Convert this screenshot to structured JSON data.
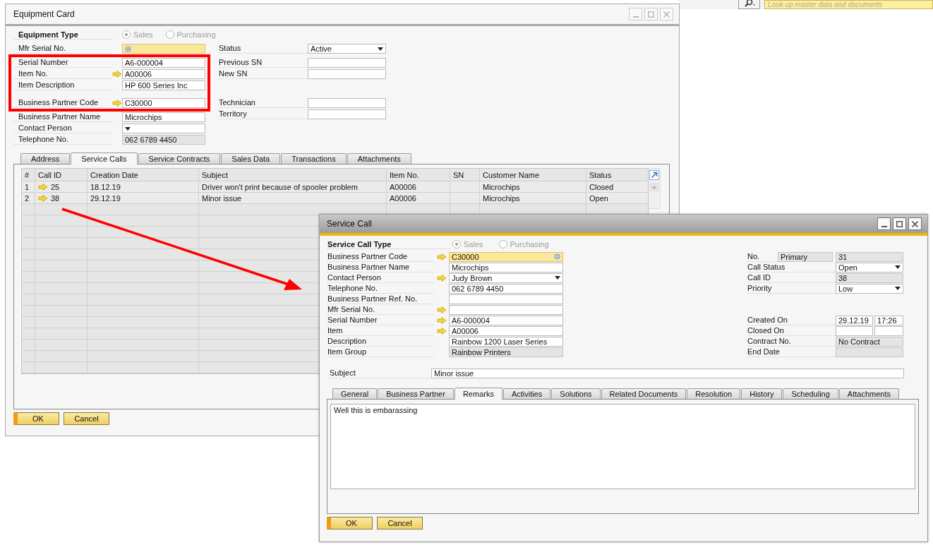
{
  "search": {
    "placeholder": "Look up master data and documents"
  },
  "equipment_card": {
    "title": "Equipment Card",
    "type": {
      "label": "Equipment Type",
      "options": [
        {
          "label": "Sales",
          "selected": true
        },
        {
          "label": "Purchasing",
          "selected": false
        }
      ]
    },
    "left_fields": [
      {
        "label": "Mfr Serial No.",
        "link": false,
        "inputs": [
          {
            "kind": "lookup"
          }
        ]
      },
      {
        "label": "Serial Number",
        "link": false,
        "inputs": [
          {
            "kind": "text",
            "value": "A6-000004"
          }
        ]
      },
      {
        "label": "Item No.",
        "link": true,
        "inputs": [
          {
            "kind": "text",
            "value": "A00006"
          }
        ]
      },
      {
        "label": "Item Description",
        "link": false,
        "inputs": [
          {
            "kind": "text",
            "value": "HP 600 Series Inc"
          }
        ]
      },
      {
        "label": "Business Partner Code",
        "link": true,
        "inputs": [
          {
            "kind": "text",
            "value": "C30000"
          }
        ]
      },
      {
        "label": "Business Partner Name",
        "link": false,
        "inputs": [
          {
            "kind": "text",
            "value": "Microchips"
          }
        ]
      },
      {
        "label": "Contact Person",
        "link": false,
        "inputs": [
          {
            "kind": "dropdown"
          }
        ]
      },
      {
        "label": "Telephone No.",
        "link": false,
        "inputs": [
          {
            "kind": "readonly",
            "value": "062 6789 4450"
          }
        ]
      }
    ],
    "right_fields": [
      {
        "label": "Status",
        "inputs": [
          {
            "kind": "dropdown",
            "value": "Active"
          }
        ]
      },
      {
        "label": "Previous SN",
        "inputs": [
          {
            "kind": "text"
          }
        ]
      },
      {
        "label": "New SN",
        "inputs": [
          {
            "kind": "text"
          }
        ]
      },
      {
        "label": "Technician",
        "inputs": [
          {
            "kind": "text"
          }
        ]
      },
      {
        "label": "Territory",
        "inputs": [
          {
            "kind": "text"
          }
        ]
      }
    ],
    "tabs": [
      {
        "label": "Address",
        "selected": false
      },
      {
        "label": "Service Calls",
        "selected": true
      },
      {
        "label": "Service Contracts",
        "selected": false
      },
      {
        "label": "Sales Data",
        "selected": false
      },
      {
        "label": "Transactions",
        "selected": false
      },
      {
        "label": "Attachments",
        "selected": false
      }
    ],
    "table": {
      "columns": [
        {
          "label": "#",
          "link": false
        },
        {
          "label": "Call ID",
          "link": true
        },
        {
          "label": "Creation Date",
          "link": false
        },
        {
          "label": "Subject",
          "link": false
        },
        {
          "label": "Item No.",
          "link": false
        },
        {
          "label": "SN",
          "link": false
        },
        {
          "label": "Customer Name",
          "link": false
        },
        {
          "label": "Status",
          "link": false
        }
      ],
      "rows": [
        [
          "1",
          "25",
          "18.12.19",
          "Driver won't print because of spooler problem",
          "A00006",
          "",
          "Microchips",
          "Closed"
        ],
        [
          "2",
          "38",
          "29.12.19",
          "Minor issue",
          "A00006",
          "",
          "Microchips",
          "Open"
        ]
      ]
    },
    "buttons": [
      "OK",
      "Cancel"
    ]
  },
  "service_call": {
    "title": "Service Call",
    "type": {
      "label": "Service Call Type",
      "options": [
        {
          "label": "Sales",
          "selected": true
        },
        {
          "label": "Purchasing",
          "selected": false
        }
      ]
    },
    "left_fields": [
      {
        "label": "Business Partner Code",
        "link": true,
        "inputs": [
          {
            "kind": "lookup",
            "value": "C30000"
          }
        ]
      },
      {
        "label": "Business Partner Name",
        "link": false,
        "inputs": [
          {
            "kind": "text",
            "value": "Microchips"
          }
        ]
      },
      {
        "label": "Contact Person",
        "link": true,
        "inputs": [
          {
            "kind": "dropdown",
            "value": "Judy Brown"
          }
        ]
      },
      {
        "label": "Telephone No.",
        "link": false,
        "inputs": [
          {
            "kind": "text",
            "value": "062 6789 4450"
          }
        ]
      },
      {
        "label": "Business Partner Ref. No.",
        "link": false,
        "inputs": [
          {
            "kind": "text"
          }
        ]
      },
      {
        "label": "Mfr Serial No.",
        "link": true,
        "inputs": [
          {
            "kind": "text"
          }
        ]
      },
      {
        "label": "Serial Number",
        "link": true,
        "inputs": [
          {
            "kind": "text",
            "value": "A6-000004"
          }
        ]
      },
      {
        "label": "Item",
        "link": true,
        "inputs": [
          {
            "kind": "text",
            "value": "A00006"
          }
        ]
      },
      {
        "label": "Description",
        "link": false,
        "inputs": [
          {
            "kind": "text",
            "value": "Rainbow 1200 Laser Series"
          }
        ]
      },
      {
        "label": "Item Group",
        "link": false,
        "inputs": [
          {
            "kind": "readonly",
            "value": "Rainbow Printers"
          }
        ]
      }
    ],
    "right_fields": [
      {
        "label": "No.",
        "inputs": [
          {
            "kind": "readonly",
            "value": "Primary"
          },
          {
            "kind": "readonly",
            "value": "31"
          }
        ]
      },
      {
        "label": "Call Status",
        "inputs": [
          {
            "kind": "dropdown",
            "value": "Open"
          }
        ]
      },
      {
        "label": "Call ID",
        "inputs": [
          {
            "kind": "readonly",
            "value": "38"
          }
        ]
      },
      {
        "label": "Priority",
        "inputs": [
          {
            "kind": "dropdown",
            "value": "Low"
          }
        ]
      },
      {
        "label": "Created On",
        "inputs": [
          {
            "kind": "text",
            "value": "29.12.19"
          },
          {
            "kind": "text",
            "value": "17:26"
          }
        ]
      },
      {
        "label": "Closed On",
        "inputs": [
          {
            "kind": "text"
          },
          {
            "kind": "text"
          }
        ]
      },
      {
        "label": "Contract No.",
        "inputs": [
          {
            "kind": "readonly",
            "value": "No Contract"
          }
        ]
      },
      {
        "label": "End Date",
        "inputs": [
          {
            "kind": "readonly"
          }
        ]
      }
    ],
    "subject": {
      "label": "Subject",
      "value": "Minor issue"
    },
    "tabs": [
      {
        "label": "General",
        "selected": false
      },
      {
        "label": "Business Partner",
        "selected": false
      },
      {
        "label": "Remarks",
        "selected": true
      },
      {
        "label": "Activities",
        "selected": false
      },
      {
        "label": "Solutions",
        "selected": false
      },
      {
        "label": "Related Documents",
        "selected": false
      },
      {
        "label": "Resolution",
        "selected": false
      },
      {
        "label": "History",
        "selected": false
      },
      {
        "label": "Scheduling",
        "selected": false
      },
      {
        "label": "Attachments",
        "selected": false
      }
    ],
    "remarks": "Well this is embarassing",
    "buttons": [
      "OK",
      "Cancel"
    ]
  }
}
